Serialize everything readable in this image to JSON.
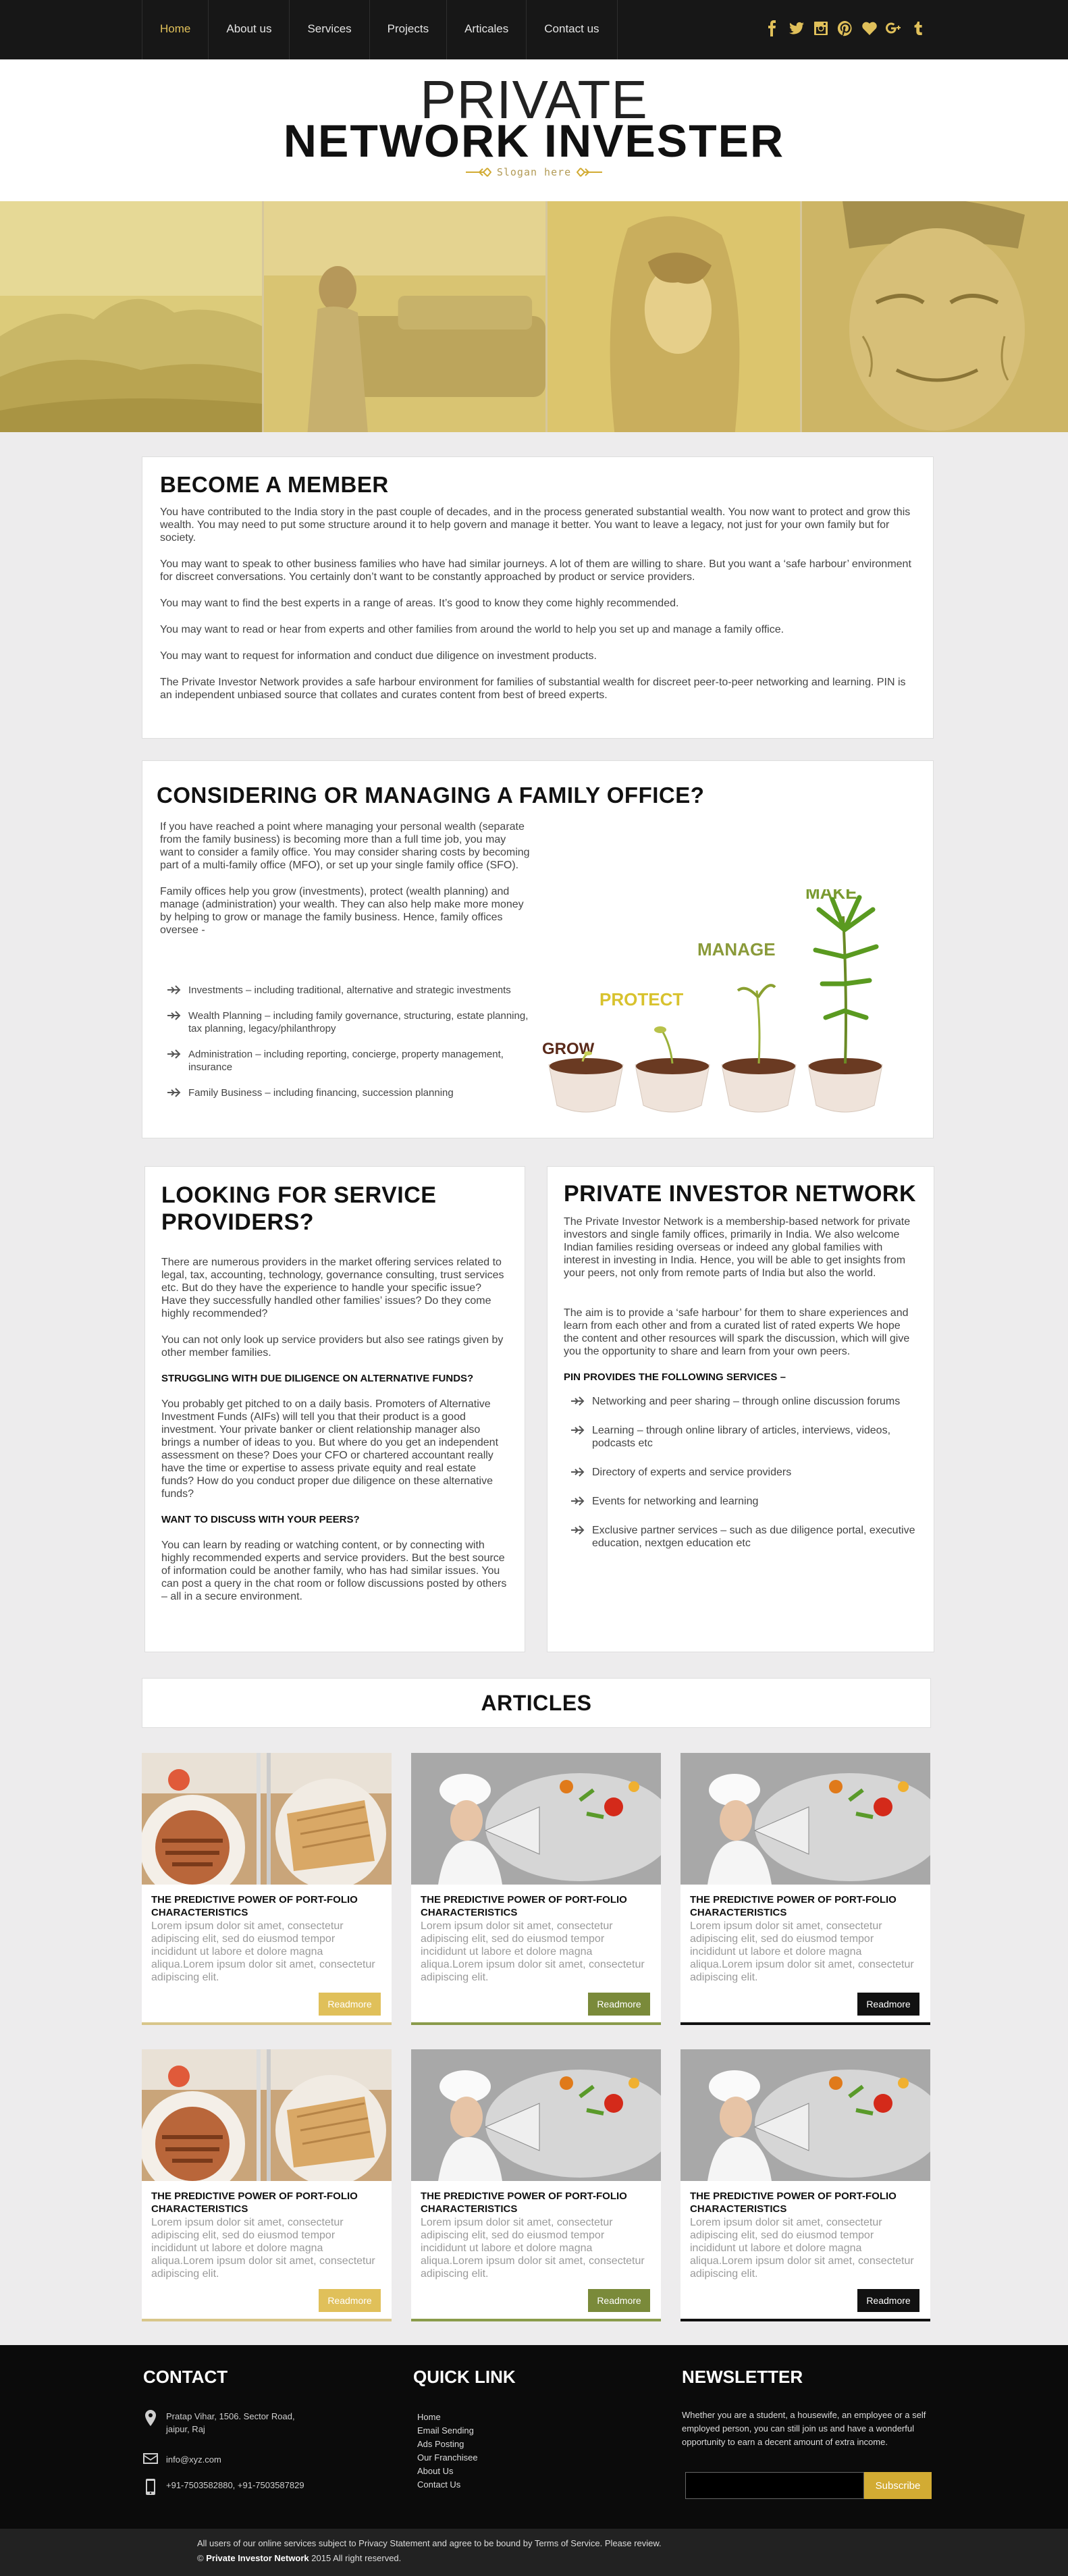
{
  "nav": {
    "items": [
      "Home",
      "About us",
      "Services",
      "Projects",
      "Articales",
      "Contact us"
    ],
    "active": "Home",
    "social": [
      "facebook-icon",
      "twitter-icon",
      "instagram-icon",
      "pinterest-icon",
      "heart-icon",
      "google-plus-icon",
      "tumblr-icon"
    ]
  },
  "header": {
    "brand_top": "PRIVATE",
    "brand_bottom": "NETWORK INVESTER",
    "slogan": "Slogan here"
  },
  "member": {
    "title": "BECOME A MEMBER",
    "paragraphs": [
      "You have contributed to the India story in the past couple of decades, and in the process generated substantial wealth. You now want to protect and grow this wealth. You may need to put some structure around it to help govern and manage it better. You want to leave a legacy, not just for your own family but for society.",
      "You may want to speak to other business families who have had similar journeys. A lot of them are willing to share. But you want a ‘safe harbour’ environment for discreet conversations. You certainly don’t want to be constantly approached by product or service providers.",
      "You may want to find the best experts in a range of areas. It’s good to know they come highly recommended.",
      "You may want to read or hear from experts and other families from around the world to help you set up and manage a family office.",
      "You may want to request for information and conduct due diligence on investment products.",
      "The Private Investor Network provides a safe harbour environment for families of substantial wealth for discreet peer-to-peer networking and learning. PIN is an independent unbiased source that collates and curates content from best of breed experts."
    ]
  },
  "family": {
    "title": "CONSIDERING OR MANAGING A FAMILY OFFICE?",
    "paragraphs": [
      "If you have reached a point where managing your personal wealth (separate from the family business) is becoming more than a full time job, you may want to consider a family office. You may consider sharing costs by becoming part of a multi-family office (MFO), or set up your single family office (SFO).",
      "Family offices help you grow (investments), protect (wealth planning) and manage (administration) your wealth. They can also help make more money by helping to grow or manage the family business. Hence, family offices oversee -"
    ],
    "items": [
      "Investments – including traditional, alternative and strategic investments",
      "Wealth Planning – including family governance, structuring, estate planning, tax planning, legacy/philanthropy",
      "Administration – including reporting, concierge, property management, insurance",
      "Family Business – including financing, succession planning"
    ],
    "stages": [
      "GROW",
      "PROTECT",
      "MANAGE",
      "MAKE"
    ]
  },
  "service": {
    "title": "LOOKING FOR SERVICE PROVIDERS?",
    "p1": "There are numerous providers in the market offering services related to legal, tax, accounting, technology, governance consulting, trust services etc. But do they have the experience to handle your specific issue? Have they successfully handled other families’ issues? Do they come highly recommended?",
    "p2": "You can not only look up service providers but also see ratings given by other member families.",
    "h1": "STRUGGLING WITH DUE DILIGENCE ON ALTERNATIVE FUNDS?",
    "p3": "You probably get pitched to on a daily basis. Promoters of Alternative Investment Funds (AIFs) will tell you that their product is a good investment. Your private banker or client relationship manager also brings a number of ideas to you. But where do you get an independent assessment on these? Does your CFO or chartered accountant really have the time or expertise to assess private equity and real estate funds? How do you conduct proper due diligence on these alternative funds?",
    "h2": "WANT TO DISCUSS WITH YOUR PEERS?",
    "p4": "You can learn by reading or watching content, or by connecting with highly recommended experts and service providers. But the best source of information could be another family, who has had similar issues. You can post a query in the chat room or follow discussions posted by others – all in a secure environment."
  },
  "network": {
    "title": "PRIVATE INVESTOR NETWORK",
    "p1": "The Private Investor Network is a membership-based network for private investors and single family offices, primarily in India. We also welcome Indian families residing overseas or indeed any global families with interest in investing in India. Hence, you will be able to get insights from your peers, not only from remote parts of India but also the world.",
    "p2": "The aim is to provide a ‘safe harbour’ for them to share experiences and learn from each other and from a curated list of rated experts We hope the content and other resources will spark the discussion, which will give you the opportunity to share and learn from your own peers.",
    "heading": "PIN PROVIDES THE FOLLOWING SERVICES –",
    "items": [
      "Networking and peer sharing – through online discussion forums",
      "Learning – through online library of articles, interviews, videos, podcasts etc",
      "Directory of experts and service providers",
      "Events for networking and learning",
      "Exclusive partner services – such as due diligence portal, executive education, nextgen education etc"
    ]
  },
  "articles": {
    "title": "ARTICLES",
    "cards": [
      {
        "title": "THE PREDICTIVE POWER OF PORT-FOLIO CHARACTERISTICS",
        "text": "Lorem ipsum dolor sit amet, consectetur adipiscing elit, sed do eiusmod tempor incididunt ut labore et dolore magna aliqua.Lorem ipsum dolor sit amet, consectetur adipiscing elit.",
        "button": "Readmore",
        "image": "food-plate",
        "accent": "#e0c05a"
      },
      {
        "title": "THE PREDICTIVE POWER OF PORT-FOLIO CHARACTERISTICS",
        "text": "Lorem ipsum dolor sit amet, consectetur adipiscing elit, sed do eiusmod tempor incididunt ut labore et dolore magna aliqua.Lorem ipsum dolor sit amet, consectetur adipiscing elit.",
        "button": "Readmore",
        "image": "chef-megaphone",
        "accent": "#7a8a3a"
      },
      {
        "title": "THE PREDICTIVE POWER OF PORT-FOLIO CHARACTERISTICS",
        "text": "Lorem ipsum dolor sit amet, consectetur adipiscing elit, sed do eiusmod tempor incididunt ut labore et dolore magna aliqua.Lorem ipsum dolor sit amet, consectetur adipiscing elit.",
        "button": "Readmore",
        "image": "chef-megaphone",
        "accent": "#111111"
      },
      {
        "title": "THE PREDICTIVE POWER OF PORT-FOLIO CHARACTERISTICS",
        "text": "Lorem ipsum dolor sit amet, consectetur adipiscing elit, sed do eiusmod tempor incididunt ut labore et dolore magna aliqua.Lorem ipsum dolor sit amet, consectetur adipiscing elit.",
        "button": "Readmore",
        "image": "food-plate",
        "accent": "#e0c05a"
      },
      {
        "title": "THE PREDICTIVE POWER OF PORT-FOLIO CHARACTERISTICS",
        "text": "Lorem ipsum dolor sit amet, consectetur adipiscing elit, sed do eiusmod tempor incididunt ut labore et dolore magna aliqua.Lorem ipsum dolor sit amet, consectetur adipiscing elit.",
        "button": "Readmore",
        "image": "chef-megaphone",
        "accent": "#7a8a3a"
      },
      {
        "title": "THE PREDICTIVE POWER OF PORT-FOLIO CHARACTERISTICS",
        "text": "Lorem ipsum dolor sit amet, consectetur adipiscing elit, sed do eiusmod tempor incididunt ut labore et dolore magna aliqua.Lorem ipsum dolor sit amet, consectetur adipiscing elit.",
        "button": "Readmore",
        "image": "chef-megaphone",
        "accent": "#111111"
      }
    ]
  },
  "footer": {
    "contact_title": "CONTACT",
    "address": "Pratap Vihar, 1506. Sector Road, jaipur, Raj",
    "email": "info@xyz.com",
    "phone": "+91-7503582880, +91-7503587829",
    "quick_title": "QUICK LINK",
    "links": [
      "Home",
      "Email Sending",
      "Ads Posting",
      "Our Franchisee",
      "About Us",
      "Contact Us"
    ],
    "newsletter_title": "NEWSLETTER",
    "newsletter_text": "Whether you are a student, a housewife, an employee or a self employed person, you can still join us and have a wonderful opportunity to earn a decent amount of extra income.",
    "subscribe": "Subscribe"
  },
  "bottom": {
    "line1": "All users of our online services subject to Privacy Statement and agree to be bound by Terms of Service. Please review.",
    "copy_prefix": "©",
    "brand": "Private Investor Network",
    "copy_suffix": "2015 All right reserved."
  },
  "colors": {
    "accent": "#e0c05a",
    "dark": "#171717",
    "olive": "#7a8a3a"
  }
}
